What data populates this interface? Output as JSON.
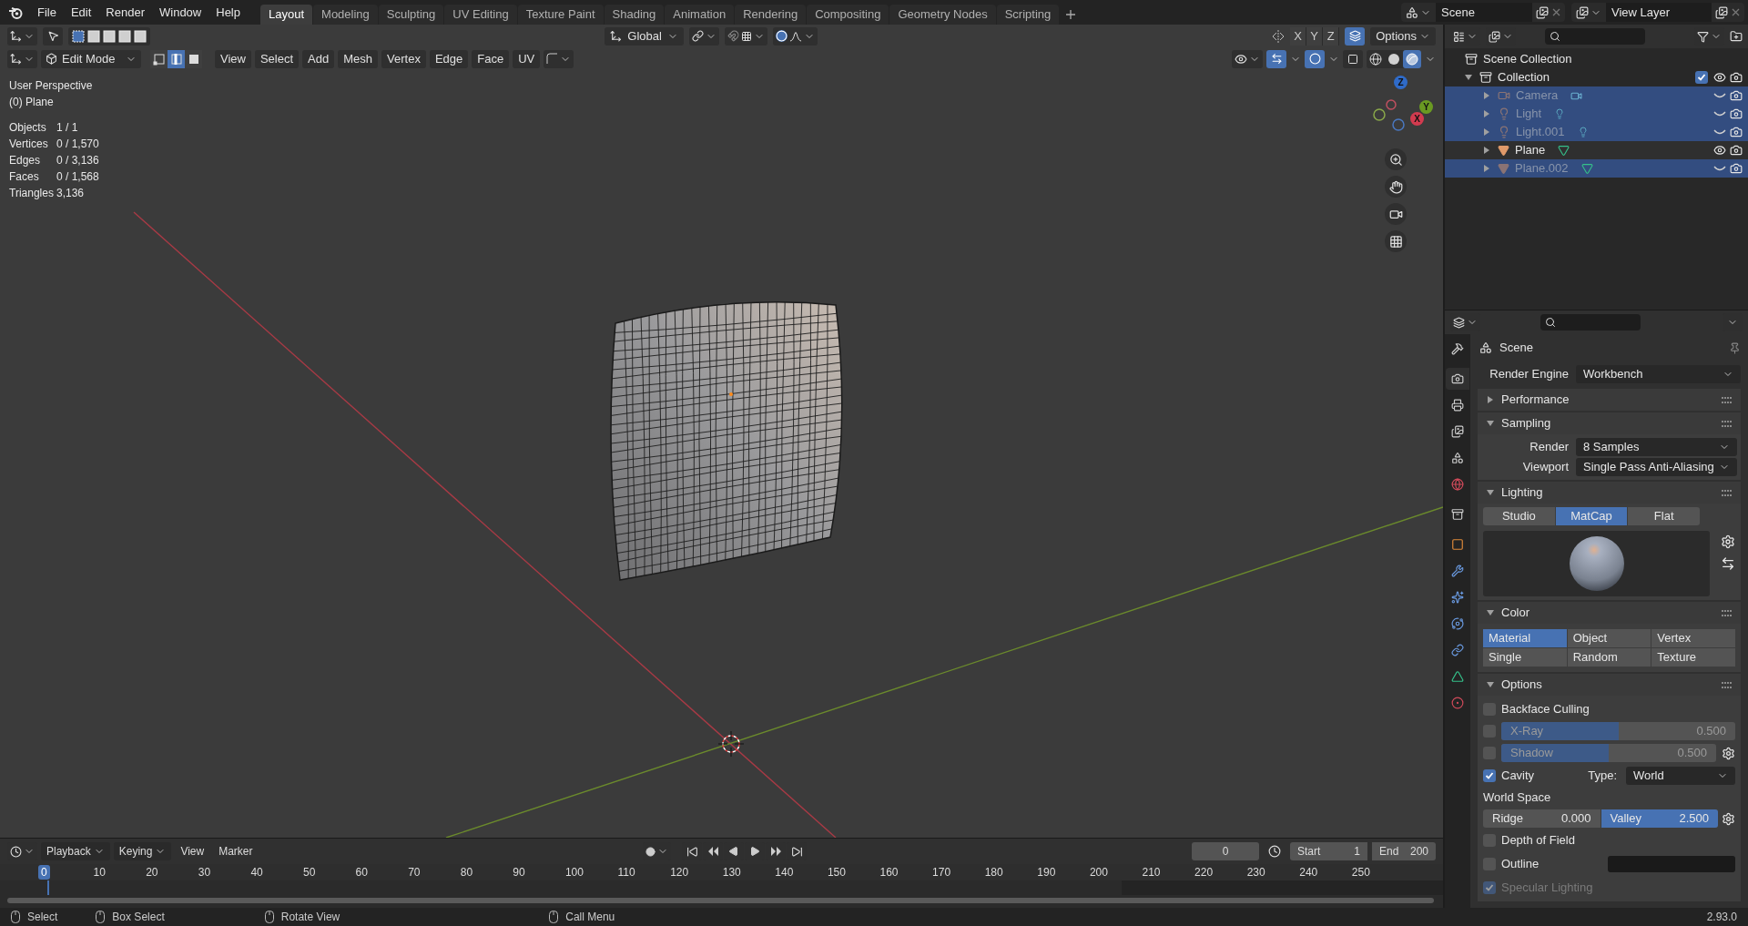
{
  "menu": [
    "File",
    "Edit",
    "Render",
    "Window",
    "Help"
  ],
  "workspaces": [
    {
      "label": "Layout",
      "selected": true
    },
    {
      "label": "Modeling",
      "selected": false
    },
    {
      "label": "Sculpting",
      "selected": false
    },
    {
      "label": "UV Editing",
      "selected": false
    },
    {
      "label": "Texture Paint",
      "selected": false
    },
    {
      "label": "Shading",
      "selected": false
    },
    {
      "label": "Animation",
      "selected": false
    },
    {
      "label": "Rendering",
      "selected": false
    },
    {
      "label": "Compositing",
      "selected": false
    },
    {
      "label": "Geometry Nodes",
      "selected": false
    },
    {
      "label": "Scripting",
      "selected": false
    }
  ],
  "scene": "Scene",
  "view_layer": "View Layer",
  "viewport": {
    "transform_orientation": "Global",
    "axes": [
      "X",
      "Y",
      "Z"
    ],
    "options": "Options",
    "mode": "Edit Mode",
    "select_modes": [
      {
        "kind": "vertex",
        "selected": false
      },
      {
        "kind": "edge",
        "selected": true
      },
      {
        "kind": "face",
        "selected": false
      }
    ],
    "menus": [
      "View",
      "Select",
      "Add",
      "Mesh",
      "Vertex",
      "Edge",
      "Face",
      "UV"
    ],
    "shading": [
      {
        "kind": "wireframe",
        "selected": false
      },
      {
        "kind": "solid",
        "selected": false
      },
      {
        "kind": "material",
        "selected": true
      }
    ],
    "view_name": "User Perspective",
    "object_label": "(0) Plane",
    "stats": [
      {
        "label": "Objects",
        "value": "1 / 1"
      },
      {
        "label": "Vertices",
        "value": "0 / 1,570"
      },
      {
        "label": "Edges",
        "value": "0 / 3,136"
      },
      {
        "label": "Faces",
        "value": "0 / 1,568"
      },
      {
        "label": "Triangles",
        "value": "3,136"
      }
    ],
    "gizmo": [
      {
        "label": "Z",
        "color": "#2f6bc9"
      },
      {
        "label": "Y",
        "color": "#6a9a22"
      },
      {
        "label": "X",
        "color": "#d23b4f"
      }
    ]
  },
  "outliner": {
    "root": "Scene Collection",
    "items": [
      {
        "label": "Collection",
        "kind": "collection",
        "expanded": true,
        "checked": true,
        "visible": true,
        "selected": false,
        "children": [
          {
            "label": "Camera",
            "kind": "camera",
            "expanded": false,
            "visible": false,
            "selected": true
          },
          {
            "label": "Light",
            "kind": "light",
            "expanded": false,
            "visible": false,
            "selected": true
          },
          {
            "label": "Light.001",
            "kind": "light",
            "expanded": false,
            "visible": false,
            "selected": true
          },
          {
            "label": "Plane",
            "kind": "mesh",
            "expanded": false,
            "visible": true,
            "selected": false
          },
          {
            "label": "Plane.002",
            "kind": "mesh",
            "expanded": false,
            "visible": false,
            "selected": true
          }
        ]
      }
    ]
  },
  "properties": {
    "tabs": [
      {
        "kind": "tool",
        "selected": false
      },
      {
        "kind": "render",
        "selected": true
      },
      {
        "kind": "output",
        "selected": false
      },
      {
        "kind": "view_layer",
        "selected": false
      },
      {
        "kind": "scene",
        "selected": false
      },
      {
        "kind": "world",
        "selected": false
      },
      {
        "kind": "collection",
        "selected": false
      },
      {
        "kind": "object",
        "selected": false
      },
      {
        "kind": "modifiers",
        "selected": false
      },
      {
        "kind": "particles",
        "selected": false
      },
      {
        "kind": "physics",
        "selected": false
      },
      {
        "kind": "constraints",
        "selected": false
      },
      {
        "kind": "data",
        "selected": false
      },
      {
        "kind": "material",
        "selected": false
      }
    ],
    "context": "Scene",
    "render_engine": {
      "label": "Render Engine",
      "value": "Workbench"
    },
    "performance": {
      "title": "Performance",
      "expanded": false
    },
    "sampling": {
      "title": "Sampling",
      "expanded": true,
      "fields": [
        {
          "label": "Render",
          "value": "8 Samples"
        },
        {
          "label": "Viewport",
          "value": "Single Pass Anti-Aliasing"
        }
      ]
    },
    "lighting": {
      "title": "Lighting",
      "expanded": true,
      "options": [
        {
          "label": "Studio",
          "selected": false
        },
        {
          "label": "MatCap",
          "selected": true
        },
        {
          "label": "Flat",
          "selected": false
        }
      ]
    },
    "color": {
      "title": "Color",
      "expanded": true,
      "options": [
        {
          "label": "Material",
          "selected": true
        },
        {
          "label": "Object",
          "selected": false
        },
        {
          "label": "Vertex",
          "selected": false
        },
        {
          "label": "Single",
          "selected": false
        },
        {
          "label": "Random",
          "selected": false
        },
        {
          "label": "Texture",
          "selected": false
        }
      ]
    },
    "options": {
      "title": "Options",
      "expanded": true,
      "rows": [
        {
          "kind": "check",
          "label": "Backface Culling",
          "checked": false,
          "disabled": false
        },
        {
          "kind": "slider",
          "label": "X-Ray",
          "value": "0.500",
          "level": 0.5,
          "checked": false,
          "gear": false
        },
        {
          "kind": "slider",
          "label": "Shadow",
          "value": "0.500",
          "level": 0.5,
          "checked": false,
          "gear": true
        },
        {
          "kind": "select",
          "label": "Cavity",
          "checked": true,
          "type_label": "Type:",
          "value": "World"
        },
        {
          "kind": "heading",
          "label": "World Space"
        },
        {
          "kind": "pair",
          "items": [
            {
              "label": "Ridge",
              "value": "0.000",
              "level": 0
            },
            {
              "label": "Valley",
              "value": "2.500",
              "level": 1
            }
          ]
        },
        {
          "kind": "check",
          "label": "Depth of Field",
          "checked": false,
          "disabled": false
        },
        {
          "kind": "color",
          "label": "Outline",
          "checked": false
        },
        {
          "kind": "check",
          "label": "Specular Lighting",
          "checked": true,
          "disabled": true
        }
      ]
    }
  },
  "timeline": {
    "menus": [
      "Playback",
      "Keying",
      "View",
      "Marker"
    ],
    "current_frame": "0",
    "start_label": "Start",
    "start": "1",
    "end_label": "End",
    "end": "200",
    "ruler": [
      "0",
      "10",
      "20",
      "30",
      "40",
      "50",
      "60",
      "70",
      "80",
      "90",
      "100",
      "110",
      "120",
      "130",
      "140",
      "150",
      "160",
      "170",
      "180",
      "190",
      "200",
      "210",
      "220",
      "230",
      "240",
      "250"
    ]
  },
  "status": {
    "hints": [
      "Select",
      "Box Select",
      "Rotate View",
      "Call Menu"
    ],
    "version": "2.93.0"
  }
}
